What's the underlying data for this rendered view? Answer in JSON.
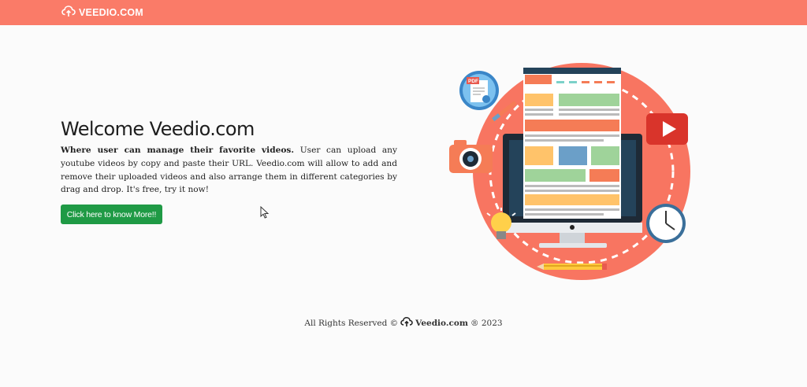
{
  "navbar": {
    "brand_text": "VEEDIO.COM",
    "brand_icon": "cloud-upload-icon",
    "colors": {
      "background": "#fa7b68",
      "text": "#ffffff"
    }
  },
  "hero": {
    "title": "Welcome Veedio.com",
    "description_bold": "Where user can manage their favorite videos.",
    "description_rest": " User can upload any youtube videos by copy and paste their URL. Veedio.com will allow to add and remove their uploaded videos and also arrange them in different categories by drag and drop. It's free, try it now!",
    "cta_label": "Click here to know More!!",
    "cta_color": "#1f9a45"
  },
  "illustration": {
    "pdf_label": "PDF",
    "icons": [
      "pdf-document-icon",
      "camera-icon",
      "video-play-icon",
      "light-bulb-icon",
      "wall-clock-icon",
      "pencil-icon",
      "monitor-icon"
    ],
    "accent": "#f87561"
  },
  "footer": {
    "prefix": "All Rights Reserved ©",
    "brand": "Veedio.com",
    "suffix": "® 2023"
  }
}
